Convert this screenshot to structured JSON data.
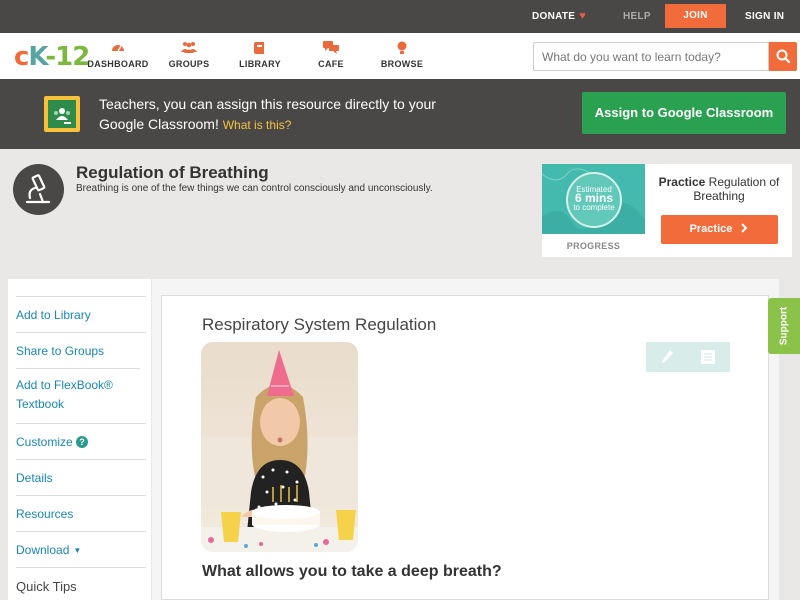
{
  "topbar": {
    "donate": "DONATE",
    "help": "HELP",
    "join": "JOIN",
    "sign_in": "SIGN IN"
  },
  "nav": {
    "items": [
      {
        "label": "DASHBOARD",
        "icon": "dashboard-icon"
      },
      {
        "label": "GROUPS",
        "icon": "groups-icon"
      },
      {
        "label": "LIBRARY",
        "icon": "library-icon"
      },
      {
        "label": "CAFE",
        "icon": "cafe-icon"
      },
      {
        "label": "BROWSE",
        "icon": "browse-icon"
      }
    ],
    "search_placeholder": "What do you want to learn today?"
  },
  "classroom_banner": {
    "text": "Teachers, you can assign this resource directly to your Google Classroom!",
    "what_link": "What is this?",
    "assign_button": "Assign to Google Classroom"
  },
  "topic": {
    "title": "Regulation of Breathing",
    "description": "Breathing is one of the few things we can control consciously and unconsciously."
  },
  "practice": {
    "estimated": "Estimated",
    "minutes": "6 mins",
    "to_complete": "to complete",
    "progress_label": "PROGRESS",
    "heading_bold": "Practice",
    "heading_rest": " Regulation of Breathing",
    "button": "Practice"
  },
  "sidebar": {
    "items": [
      {
        "label": "Add to Library"
      },
      {
        "label": "Share to Groups"
      },
      {
        "label": "Add to FlexBook® Textbook"
      },
      {
        "label": "Customize"
      },
      {
        "label": "Details"
      },
      {
        "label": "Resources"
      },
      {
        "label": "Download"
      },
      {
        "label": "Quick Tips"
      }
    ],
    "help_mark": "?"
  },
  "content": {
    "concept_title": "Respiratory System Regulation",
    "question": "What allows you to take a deep breath?"
  },
  "support_tab": "Support",
  "colors": {
    "accent_orange": "#f26b3a",
    "classroom_green": "#2aa051",
    "link_blue": "#1b86b6",
    "support_green": "#8bc34a",
    "practice_teal": "#44b9ad"
  }
}
